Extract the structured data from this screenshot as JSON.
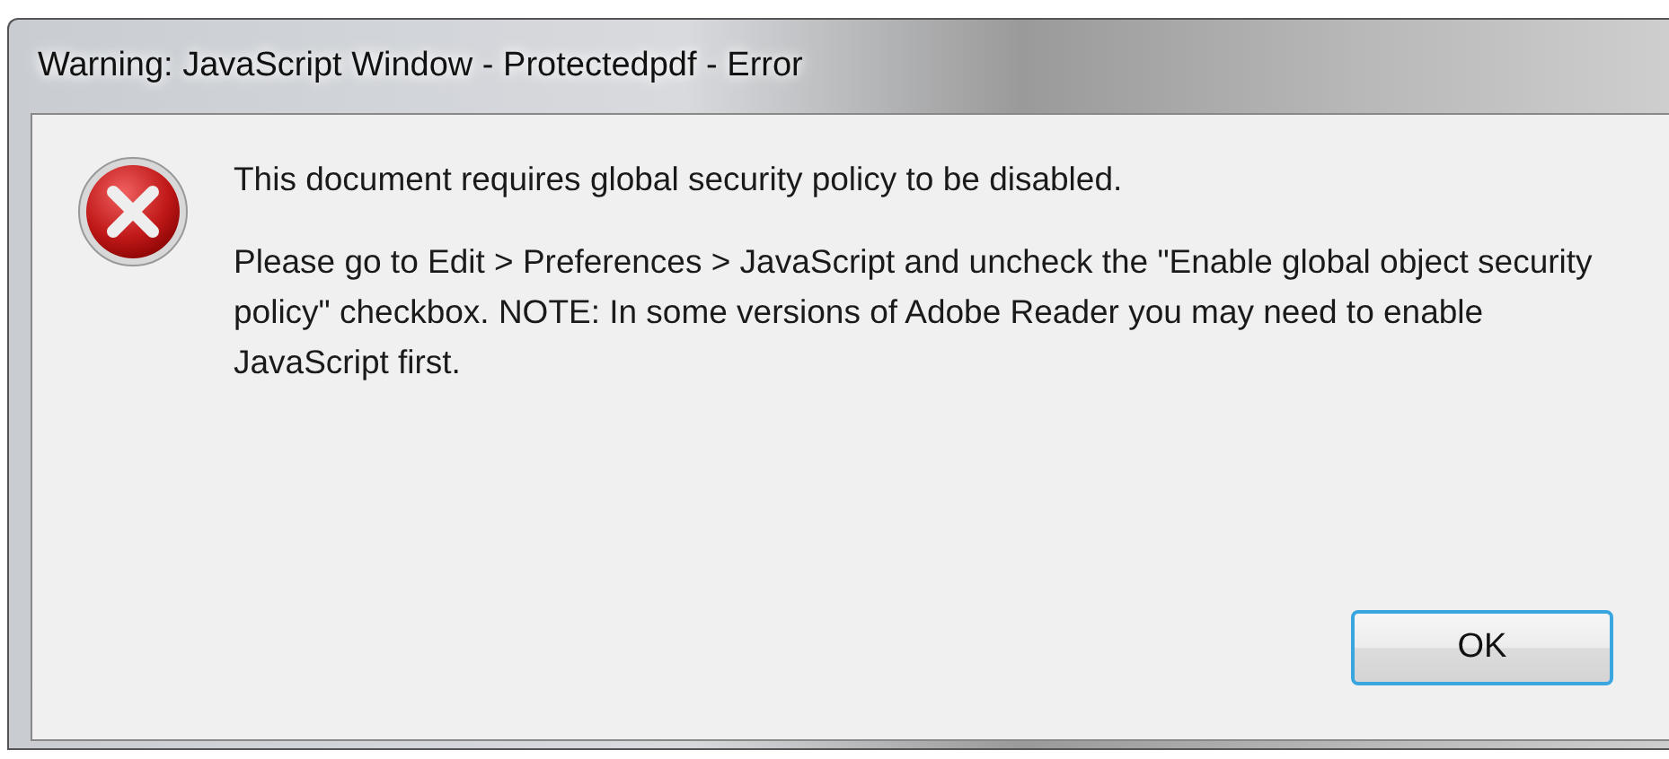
{
  "window": {
    "title": "Warning: JavaScript Window - Protectedpdf - Error"
  },
  "message": "This document requires global security policy to be disabled.",
  "detail": "Please go to Edit > Preferences > JavaScript and uncheck the \"Enable global object security policy\" checkbox. NOTE: In some versions of Adobe Reader you may need to enable JavaScript first.",
  "buttons": [
    {
      "label": "OK",
      "focused": true
    }
  ]
}
